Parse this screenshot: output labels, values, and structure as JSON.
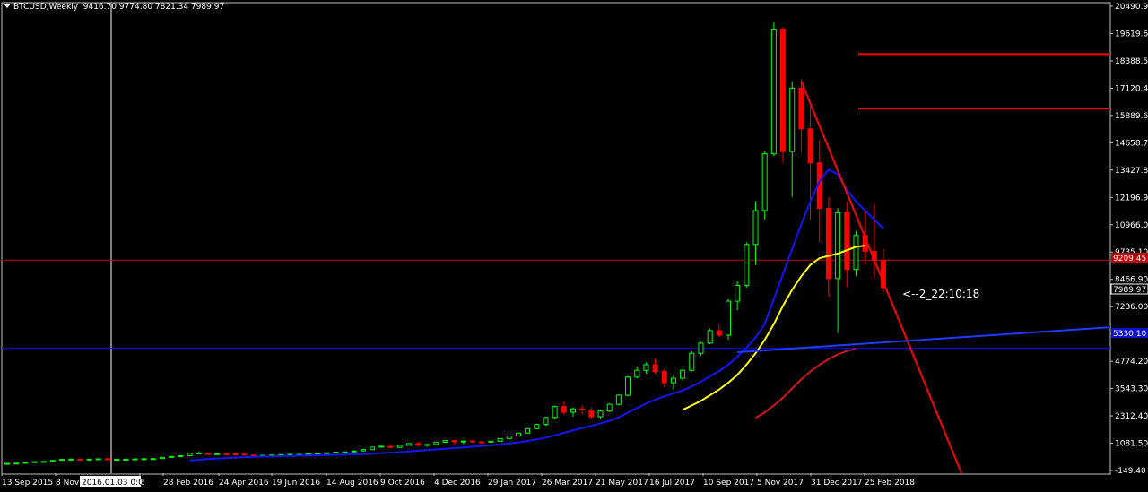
{
  "header": {
    "symbol": "BTCUSD,Weekly",
    "ohlc": "9416.70 9774.80 7821.34 7989.97"
  },
  "annotation": "<--2_22:10:18",
  "crosshair_label": "2016.01.03 0:00",
  "colors": {
    "background": "#000000",
    "frame": "#c0c0c0",
    "bull": "#00ff00",
    "bear": "#ff0000",
    "ma_blue": "#1414ff",
    "ma_yellow": "#ffff00",
    "ma_red": "#d01818",
    "hline_red": "#ff0000",
    "hline_blue": "#0000ff",
    "trend_red": "#ff0000",
    "trend_blue": "#1e3cff"
  },
  "chart_data": {
    "type": "candlestick",
    "title": "BTCUSD,Weekly",
    "ylim": [
      -149.4,
      20490.91
    ],
    "x_tick_labels": [
      "13 Sep 2015",
      "8 Nov",
      "2016.01.03 0:00",
      "6",
      "28 Feb 2016",
      "24 Apr 2016",
      "19 Jun 2016",
      "14 Aug 2016",
      "9 Oct 2016",
      "4 Dec 2016",
      "29 Jan 2017",
      "26 Mar 2017",
      "21 May 2017",
      "16 Jul 2017",
      "10 Sep 2017",
      "5 Nov 2017",
      "31 Dec 2017",
      "25 Feb 2018"
    ],
    "y_tick_labels": [
      "20490.91",
      "19619.60",
      "18388.50",
      "17120.40",
      "15889.60",
      "14658.70",
      "13427.80",
      "12196.90",
      "10966.00",
      "9735.10",
      "8466.90",
      "7236.00",
      "6005.10",
      "4774.20",
      "3543.30",
      "2312.40",
      "1081.50",
      "-149.40"
    ],
    "current_price_label": "7989.97",
    "horizontal_levels": [
      {
        "label": "9209.45",
        "value": 9209.45,
        "color": "red"
      },
      {
        "label": "5330.10",
        "value": 5330.1,
        "color": "blue"
      }
    ],
    "resistance_levels": [
      18300,
      15900
    ],
    "series_candles": [
      [
        230,
        260,
        220,
        245
      ],
      [
        245,
        270,
        235,
        255
      ],
      [
        255,
        300,
        245,
        290
      ],
      [
        290,
        330,
        280,
        320
      ],
      [
        320,
        340,
        300,
        330
      ],
      [
        330,
        380,
        320,
        375
      ],
      [
        375,
        430,
        360,
        420
      ],
      [
        420,
        460,
        400,
        430
      ],
      [
        430,
        450,
        380,
        400
      ],
      [
        400,
        440,
        390,
        430
      ],
      [
        430,
        460,
        420,
        445
      ],
      [
        445,
        460,
        400,
        410
      ],
      [
        410,
        430,
        400,
        425
      ],
      [
        425,
        440,
        410,
        430
      ],
      [
        430,
        450,
        415,
        440
      ],
      [
        440,
        460,
        425,
        450
      ],
      [
        450,
        470,
        430,
        455
      ],
      [
        455,
        520,
        450,
        510
      ],
      [
        510,
        560,
        500,
        550
      ],
      [
        550,
        600,
        530,
        580
      ],
      [
        580,
        700,
        570,
        690
      ],
      [
        690,
        780,
        650,
        700
      ],
      [
        700,
        720,
        620,
        640
      ],
      [
        640,
        680,
        610,
        670
      ],
      [
        670,
        690,
        640,
        660
      ],
      [
        660,
        680,
        630,
        650
      ],
      [
        650,
        670,
        600,
        610
      ],
      [
        610,
        620,
        560,
        590
      ],
      [
        590,
        610,
        570,
        600
      ],
      [
        600,
        620,
        580,
        610
      ],
      [
        610,
        640,
        600,
        630
      ],
      [
        630,
        650,
        610,
        640
      ],
      [
        640,
        650,
        620,
        640
      ],
      [
        640,
        670,
        630,
        660
      ],
      [
        660,
        700,
        650,
        690
      ],
      [
        690,
        720,
        680,
        710
      ],
      [
        710,
        750,
        700,
        740
      ],
      [
        740,
        760,
        720,
        750
      ],
      [
        750,
        800,
        740,
        790
      ],
      [
        790,
        860,
        780,
        850
      ],
      [
        850,
        980,
        840,
        960
      ],
      [
        960,
        1010,
        940,
        1000
      ],
      [
        1000,
        1010,
        900,
        950
      ],
      [
        950,
        1050,
        930,
        1040
      ],
      [
        1040,
        1130,
        1020,
        1120
      ],
      [
        1120,
        1200,
        980,
        1050
      ],
      [
        1050,
        1100,
        970,
        1080
      ],
      [
        1080,
        1200,
        1060,
        1180
      ],
      [
        1180,
        1270,
        1150,
        1250
      ],
      [
        1250,
        1280,
        1100,
        1200
      ],
      [
        1200,
        1250,
        1100,
        1230
      ],
      [
        1230,
        1260,
        1150,
        1190
      ],
      [
        1190,
        1220,
        1120,
        1180
      ],
      [
        1180,
        1230,
        1160,
        1220
      ],
      [
        1220,
        1350,
        1200,
        1340
      ],
      [
        1340,
        1460,
        1320,
        1450
      ],
      [
        1450,
        1590,
        1430,
        1580
      ],
      [
        1580,
        1800,
        1560,
        1780
      ],
      [
        1780,
        2000,
        1750,
        1960
      ],
      [
        1960,
        2300,
        1900,
        2270
      ],
      [
        2270,
        2800,
        2200,
        2750
      ],
      [
        2750,
        2950,
        2400,
        2500
      ],
      [
        2500,
        2700,
        2300,
        2650
      ],
      [
        2650,
        2800,
        2400,
        2600
      ],
      [
        2600,
        2700,
        2200,
        2300
      ],
      [
        2300,
        2600,
        2200,
        2550
      ],
      [
        2550,
        2900,
        2500,
        2850
      ],
      [
        2850,
        3300,
        2800,
        3250
      ],
      [
        3250,
        4100,
        3200,
        4050
      ],
      [
        4050,
        4500,
        4000,
        4350
      ],
      [
        4350,
        4700,
        4200,
        4600
      ],
      [
        4600,
        4850,
        4200,
        4300
      ],
      [
        4300,
        4400,
        3600,
        3800
      ],
      [
        3800,
        4100,
        3500,
        4000
      ],
      [
        4000,
        4400,
        3900,
        4350
      ],
      [
        4350,
        5200,
        4300,
        5100
      ],
      [
        5100,
        5600,
        5000,
        5550
      ],
      [
        5550,
        6200,
        5500,
        6100
      ],
      [
        6100,
        6400,
        5800,
        5900
      ],
      [
        5900,
        7500,
        5700,
        7400
      ],
      [
        7400,
        8300,
        7000,
        8100
      ],
      [
        8100,
        10000,
        8000,
        9900
      ],
      [
        9900,
        11800,
        9000,
        11400
      ],
      [
        11400,
        14000,
        11000,
        13900
      ],
      [
        13900,
        19700,
        13800,
        19400
      ],
      [
        19400,
        19500,
        13500,
        14000
      ],
      [
        14000,
        17100,
        12000,
        16800
      ],
      [
        16800,
        17200,
        14000,
        15000
      ],
      [
        15000,
        16000,
        11000,
        13500
      ],
      [
        13500,
        14500,
        10000,
        11500
      ],
      [
        11500,
        12000,
        7600,
        8400
      ],
      [
        8400,
        11500,
        6000,
        11300
      ],
      [
        11300,
        11800,
        8000,
        8800
      ],
      [
        8800,
        10500,
        8500,
        10300
      ],
      [
        10300,
        11400,
        9000,
        9600
      ],
      [
        9600,
        11700,
        8400,
        9200
      ],
      [
        9200,
        9700,
        7800,
        8000
      ]
    ],
    "series": [
      {
        "name": "ma_blue",
        "values": [
          null,
          null,
          null,
          null,
          null,
          null,
          null,
          null,
          null,
          null,
          null,
          null,
          null,
          null,
          null,
          null,
          null,
          null,
          null,
          null,
          380,
          400,
          430,
          460,
          480,
          500,
          520,
          535,
          545,
          555,
          565,
          575,
          585,
          592,
          600,
          610,
          620,
          630,
          640,
          655,
          675,
          700,
          720,
          740,
          770,
          800,
          830,
          860,
          890,
          920,
          950,
          980,
          1010,
          1040,
          1080,
          1120,
          1170,
          1230,
          1300,
          1380,
          1480,
          1590,
          1700,
          1800,
          1900,
          2000,
          2130,
          2280,
          2480,
          2680,
          2880,
          3060,
          3200,
          3330,
          3460,
          3640,
          3850,
          4080,
          4320,
          4600,
          4950,
          5350,
          5800,
          6400,
          7500,
          8600,
          9700,
          10800,
          11800,
          12700,
          13200,
          13000,
          12300,
          11800,
          11400,
          11000,
          10600
        ]
      },
      {
        "name": "ma_yellow",
        "values": [
          null,
          null,
          null,
          null,
          null,
          null,
          null,
          null,
          null,
          null,
          null,
          null,
          null,
          null,
          null,
          null,
          null,
          null,
          null,
          null,
          null,
          null,
          null,
          null,
          null,
          null,
          null,
          null,
          null,
          null,
          null,
          null,
          null,
          null,
          null,
          null,
          null,
          null,
          null,
          null,
          null,
          null,
          null,
          null,
          null,
          null,
          null,
          null,
          null,
          null,
          null,
          null,
          null,
          null,
          null,
          null,
          null,
          null,
          null,
          null,
          null,
          null,
          null,
          null,
          null,
          null,
          null,
          null,
          null,
          null,
          null,
          null,
          null,
          null,
          2600,
          2800,
          3000,
          3250,
          3500,
          3800,
          4150,
          4600,
          5100,
          5700,
          6400,
          7200,
          7900,
          8500,
          9000,
          9300,
          9400,
          9500,
          9650,
          9800,
          9850
        ]
      },
      {
        "name": "ma_red",
        "values": [
          null,
          null,
          null,
          null,
          null,
          null,
          null,
          null,
          null,
          null,
          null,
          null,
          null,
          null,
          null,
          null,
          null,
          null,
          null,
          null,
          null,
          null,
          null,
          null,
          null,
          null,
          null,
          null,
          null,
          null,
          null,
          null,
          null,
          null,
          null,
          null,
          null,
          null,
          null,
          null,
          null,
          null,
          null,
          null,
          null,
          null,
          null,
          null,
          null,
          null,
          null,
          null,
          null,
          null,
          null,
          null,
          null,
          null,
          null,
          null,
          null,
          null,
          null,
          null,
          null,
          null,
          null,
          null,
          null,
          null,
          null,
          null,
          null,
          null,
          null,
          null,
          null,
          null,
          null,
          null,
          null,
          null,
          2250,
          2500,
          2800,
          3150,
          3550,
          3950,
          4300,
          4600,
          4850,
          5050,
          5200,
          5300
        ]
      }
    ]
  }
}
